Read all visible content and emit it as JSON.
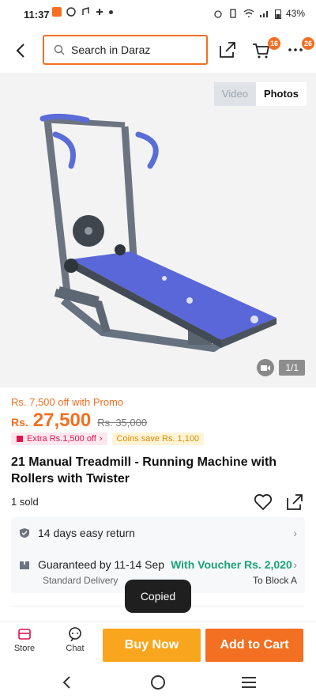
{
  "status_bar": {
    "time": "11:37",
    "battery": "43%"
  },
  "header": {
    "search_placeholder": "Search in Daraz",
    "cart_count": "16",
    "more_count": "26"
  },
  "gallery": {
    "tabs": [
      "Video",
      "Photos"
    ],
    "pager": "1/1"
  },
  "product": {
    "promo": "Rs. 7,500 off with Promo",
    "currency": "Rs.",
    "price": "27,500",
    "old_price": "Rs. 35,000",
    "extra_chip": "Extra Rs.1,500 off",
    "coins_chip": "Coins save Rs. 1,100",
    "title": "21 Manual Treadmill - Running Machine with Rollers with Twister",
    "sold": "1 sold"
  },
  "services": {
    "return": "14 days easy return",
    "delivery": "Guaranteed by 11-14 Sep",
    "voucher": "With Voucher Rs. 2,020",
    "delivery_type": "Standard Delivery",
    "destination": "To Block A"
  },
  "toast": "Copied",
  "bottom_bar": {
    "store": "Store",
    "chat": "Chat",
    "buy_now": "Buy Now",
    "add_to_cart": "Add to Cart"
  },
  "colors": {
    "accent": "#f36f21",
    "buy": "#f9a61e",
    "voucher": "#1aa37a"
  }
}
